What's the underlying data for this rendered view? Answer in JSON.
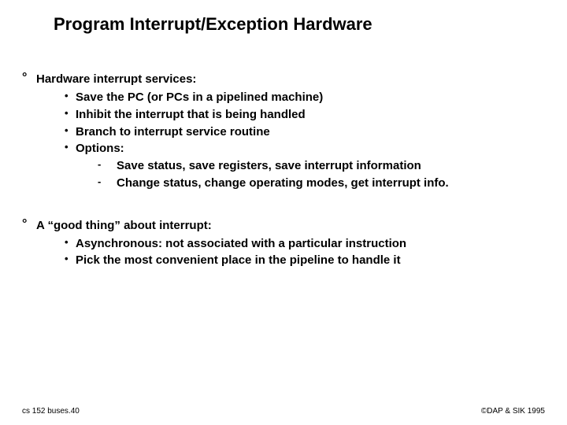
{
  "title": "Program Interrupt/Exception Hardware",
  "sections": [
    {
      "lead": "Hardware interrupt services:",
      "subs": [
        {
          "text": "Save the PC (or PCs in a pipelined machine)"
        },
        {
          "text": "Inhibit the interrupt that is being handled"
        },
        {
          "text": "Branch to interrupt service routine"
        },
        {
          "text": "Options:",
          "subsubs": [
            "Save status, save registers, save interrupt information",
            "Change status, change operating modes, get interrupt info."
          ]
        }
      ]
    },
    {
      "lead": "A “good thing” about interrupt:",
      "subs": [
        {
          "text": "Asynchronous: not associated with a particular instruction"
        },
        {
          "text": "Pick the most convenient place in the pipeline to handle it"
        }
      ]
    }
  ],
  "footer": {
    "left": "cs 152 buses.40",
    "right": "©DAP & SIK 1995"
  }
}
